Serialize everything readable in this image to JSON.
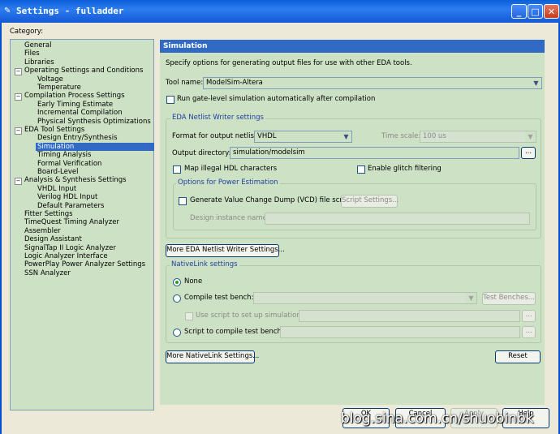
{
  "window": {
    "title": "Settings - fulladder"
  },
  "category_label": "Category:",
  "tree": [
    {
      "label": "General",
      "level": 1
    },
    {
      "label": "Files",
      "level": 1
    },
    {
      "label": "Libraries",
      "level": 1
    },
    {
      "label": "Operating Settings and Conditions",
      "level": 0,
      "expander": "−"
    },
    {
      "label": "Voltage",
      "level": 2
    },
    {
      "label": "Temperature",
      "level": 2
    },
    {
      "label": "Compilation Process Settings",
      "level": 0,
      "expander": "−"
    },
    {
      "label": "Early Timing Estimate",
      "level": 2
    },
    {
      "label": "Incremental Compilation",
      "level": 2
    },
    {
      "label": "Physical Synthesis Optimizations",
      "level": 2
    },
    {
      "label": "EDA Tool Settings",
      "level": 0,
      "expander": "−"
    },
    {
      "label": "Design Entry/Synthesis",
      "level": 2
    },
    {
      "label": "Simulation",
      "level": 2,
      "selected": true
    },
    {
      "label": "Timing Analysis",
      "level": 2
    },
    {
      "label": "Formal Verification",
      "level": 2
    },
    {
      "label": "Board-Level",
      "level": 2
    },
    {
      "label": "Analysis & Synthesis Settings",
      "level": 0,
      "expander": "−"
    },
    {
      "label": "VHDL Input",
      "level": 2
    },
    {
      "label": "Verilog HDL Input",
      "level": 2
    },
    {
      "label": "Default Parameters",
      "level": 2
    },
    {
      "label": "Fitter Settings",
      "level": 1
    },
    {
      "label": "TimeQuest Timing Analyzer",
      "level": 1
    },
    {
      "label": "Assembler",
      "level": 1
    },
    {
      "label": "Design Assistant",
      "level": 1
    },
    {
      "label": "SignalTap II Logic Analyzer",
      "level": 1
    },
    {
      "label": "Logic Analyzer Interface",
      "level": 1
    },
    {
      "label": "PowerPlay Power Analyzer Settings",
      "level": 1
    },
    {
      "label": "SSN Analyzer",
      "level": 1
    }
  ],
  "panel": {
    "title": "Simulation",
    "description": "Specify options for generating output files for use with other EDA tools.",
    "tool_name_label": "Tool name:",
    "tool_name_value": "ModelSim-Altera",
    "run_gate_label": "Run gate-level simulation automatically after compilation",
    "netlist_group": "EDA Netlist Writer settings",
    "format_label": "Format for output netlist:",
    "format_value": "VHDL",
    "time_scale_label": "Time scale:",
    "time_scale_value": "100 us",
    "output_dir_label": "Output directory:",
    "output_dir_value": "simulation/modelsim",
    "browse": "...",
    "map_illegal_label": "Map illegal HDL characters",
    "enable_glitch_label": "Enable glitch filtering",
    "power_group": "Options for Power Estimation",
    "vcd_label": "Generate Value Change Dump (VCD) file script",
    "script_settings": "Script Settings...",
    "design_instance_label": "Design instance name:",
    "more_eda_btn": "More EDA Netlist Writer Settings...",
    "nativelink_group": "NativeLink settings",
    "none_label": "None",
    "compile_tb_label": "Compile test bench:",
    "test_benches_btn": "Test Benches...",
    "use_script_label": "Use script to set up simulation:",
    "script_compile_label": "Script to compile test bench:",
    "more_nativelink_btn": "More NativeLink Settings...",
    "reset_btn": "Reset"
  },
  "footer": {
    "ok": "OK",
    "cancel": "Cancel",
    "apply": "Apply",
    "help": "Help"
  },
  "watermark": "blog.sina.com.cn/shuobinbk"
}
